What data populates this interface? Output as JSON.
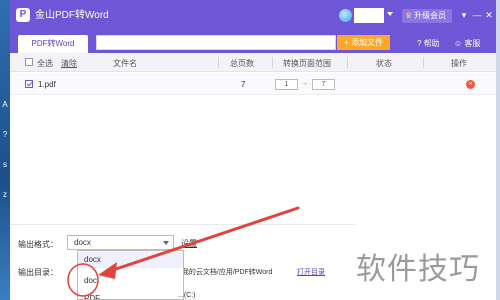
{
  "app": {
    "logo_glyph": "P",
    "title": "金山PDF转Word",
    "vip_label": "升级会员",
    "vip_icon": "crown-icon"
  },
  "window_controls": {
    "skin": "▾",
    "minimize": "—",
    "close": "✕"
  },
  "desktop": {
    "glyphs": [
      "A",
      "?",
      "s",
      "z"
    ]
  },
  "toolbar": {
    "tab_label": "PDF转Word",
    "path_value": "",
    "add_file_label": "+ 添加文件",
    "help_label": "帮助",
    "help_icon": "help-icon",
    "service_label": "客服",
    "service_icon": "chat-icon"
  },
  "table": {
    "select_all": "全选",
    "clear": "清除",
    "columns": {
      "name": "文件名",
      "pages": "总页数",
      "range": "转换页面范围",
      "status": "状态",
      "action": "操作"
    },
    "rows": [
      {
        "checked": true,
        "name": "1.pdf",
        "pages": "7",
        "range_from": "1",
        "range_arrow": "→",
        "range_to": "7",
        "status": "",
        "delete_icon": "delete-icon"
      }
    ]
  },
  "footer": {
    "format_label": "输出格式：",
    "format_value": "docx",
    "settings_label": "设置",
    "dir_label": "输出目录：",
    "dir_path": "//我的云文档/应用/PDF转Word",
    "open_dir_label": "打开目录",
    "partial_text": "...(C:)"
  },
  "dropdown": {
    "options": [
      "docx",
      "doc",
      "PDF"
    ]
  },
  "annotations": {
    "arrow_color": "#e0443c",
    "circle_color": "#e0443c"
  },
  "watermark": "软件技巧",
  "colors": {
    "accent": "#6e56d6",
    "add_button": "#ffa726",
    "delete": "#f0553e"
  }
}
